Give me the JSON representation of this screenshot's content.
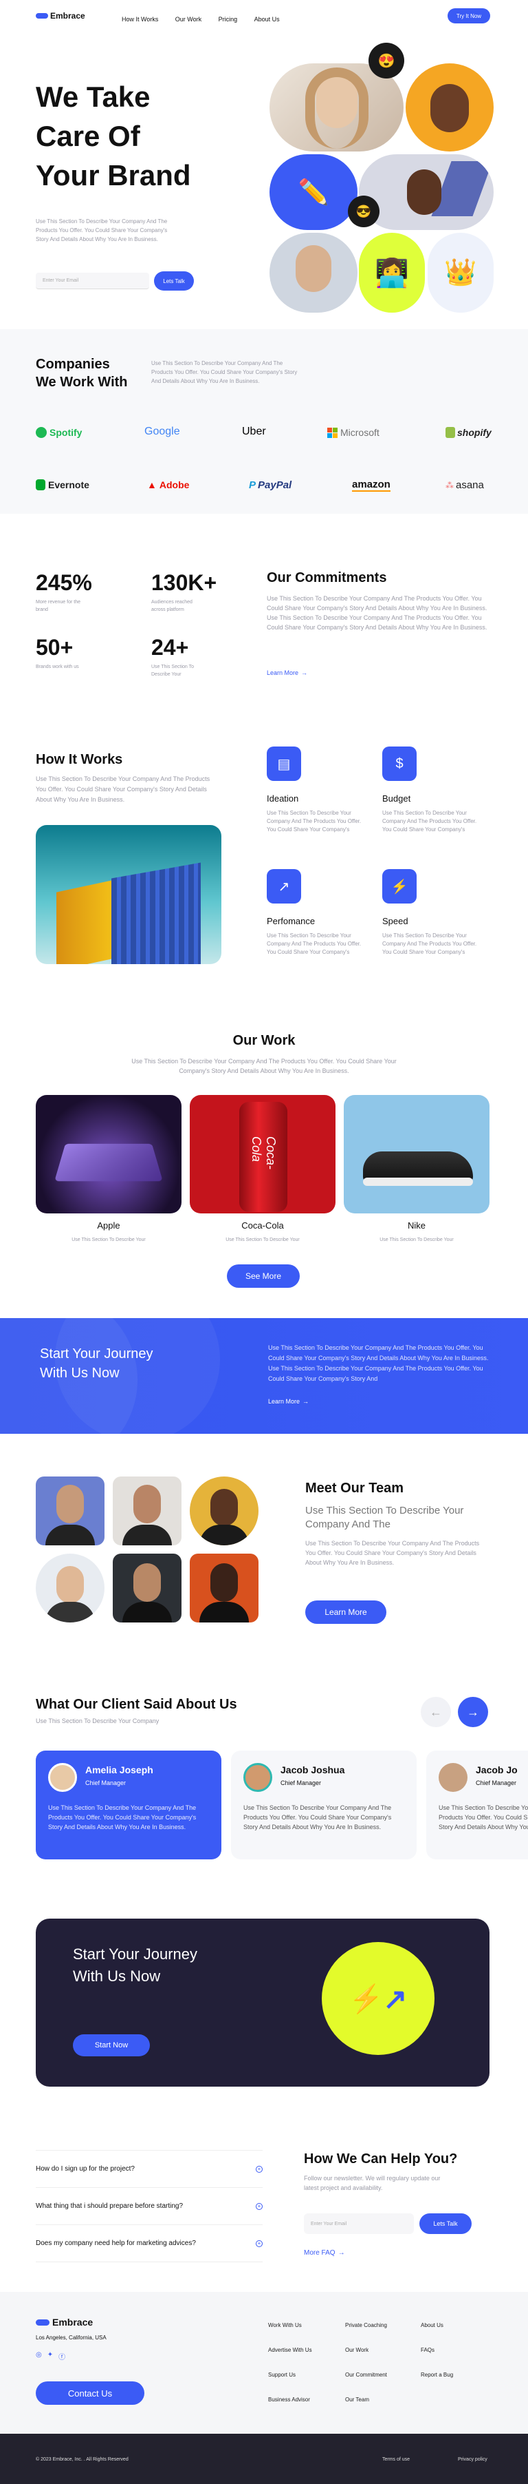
{
  "nav": {
    "logo": "Embrace",
    "links": [
      "How It Works",
      "Our Work",
      "Pricing",
      "About Us"
    ],
    "cta": "Try It Now"
  },
  "hero": {
    "line1": "We Take",
    "line2": "Care Of",
    "line3": "Your Brand",
    "desc": "Use This Section To Describe Your Company And The Products You Offer. You Could Share Your Company's Story And Details About Why You Are In Business.",
    "email_placeholder": "Enter Your Email",
    "button": "Lets Talk"
  },
  "companies": {
    "title1": "Companies",
    "title2": "We Work With",
    "desc": "Use This Section To Describe Your Company And The Products You Offer. You Could Share Your Company's Story And Details About Why You Are In Business.",
    "logos": [
      "Spotify",
      "Google",
      "Uber",
      "Microsoft",
      "shopify",
      "Evernote",
      "Adobe",
      "PayPal",
      "amazon",
      "asana"
    ]
  },
  "stats": {
    "items": [
      {
        "value": "245%",
        "label": "More revenue for the brand"
      },
      {
        "value": "130K+",
        "label": "Audiences reached across platform"
      },
      {
        "value": "50+",
        "label": "Brands work with us"
      },
      {
        "value": "24+",
        "label": "Use This Section To Describe Your"
      }
    ],
    "title": "Our Commitments",
    "desc": "Use This Section To Describe Your Company And The Products You Offer. You Could Share Your Company's Story And Details About Why You Are In Business. Use This Section To Describe Your Company And The Products You Offer. You Could Share Your Company's Story And Details About Why You Are In Business.",
    "link": "Learn More"
  },
  "how": {
    "title": "How It Works",
    "desc": "Use This Section To Describe Your Company And The Products You Offer. You Could Share Your Company's Story And Details About Why You Are In Business.",
    "features": [
      {
        "title": "Ideation",
        "desc": "Use This Section To Describe Your Company And The Products You Offer. You Could Share Your Company's"
      },
      {
        "title": "Budget",
        "desc": "Use This Section To Describe Your Company And The Products You Offer. You Could Share Your Company's"
      },
      {
        "title": "Perfomance",
        "desc": "Use This Section To Describe Your Company And The Products You Offer. You Could Share Your Company's"
      },
      {
        "title": "Speed",
        "desc": "Use This Section To Describe Your Company And The Products You Offer. You Could Share Your Company's"
      }
    ]
  },
  "work": {
    "title": "Our Work",
    "desc": "Use This Section To Describe Your Company And The Products You Offer. You Could Share Your Company's Story And Details About Why You Are In Business.",
    "items": [
      {
        "name": "Apple",
        "desc": "Use This Section To Describe Your"
      },
      {
        "name": "Coca-Cola",
        "desc": "Use This Section To Describe Your"
      },
      {
        "name": "Nike",
        "desc": "Use This Section To Describe Your"
      }
    ],
    "button": "See More"
  },
  "journey": {
    "title1": "Start Your Journey",
    "title2": "With Us Now",
    "desc": "Use This Section To Describe Your Company And The Products You Offer. You Could Share Your Company's Story And Details About Why You Are In Business. Use This Section To Describe Your Company And The Products You Offer. You Could Share Your Company's Story And",
    "link": "Learn More"
  },
  "team": {
    "title": "Meet Our Team",
    "subtitle": "Use This Section To Describe Your Company And The",
    "desc": "Use This Section To Describe Your Company And The Products You Offer. You Could Share Your Company's Story And Details About Why You Are In Business.",
    "button": "Learn More"
  },
  "testimonials": {
    "title": "What Our Client Said About Us",
    "subtitle": "Use This Section To Describe Your Company",
    "cards": [
      {
        "name": "Amelia Joseph",
        "role": "Chief Manager",
        "text": "Use This Section To Describe Your Company And The Products You Offer. You Could Share Your Company's Story And Details About Why You Are In Business."
      },
      {
        "name": "Jacob Joshua",
        "role": "Chief Manager",
        "text": "Use This Section To Describe Your Company And The Products You Offer. You Could Share Your Company's Story And Details About Why You Are In Business."
      },
      {
        "name": "Jacob Jo",
        "role": "Chief Manager",
        "text": "Use This Section To Describe Your Company And The Products You Offer. You Could Share Your Company's Story And Details About Why You Are In Business."
      }
    ]
  },
  "cta": {
    "title1": "Start Your Journey",
    "title2": "With Us Now",
    "button": "Start Now"
  },
  "faq": {
    "items": [
      "How do I sign up for the project?",
      "What thing that i should prepare before starting?",
      "Does my company need help for marketing advices?"
    ],
    "title": "How We Can Help You?",
    "desc": "Follow our newsletter. We will regulary update our latest project and availability.",
    "placeholder": "Enter Your Email",
    "button": "Lets Talk",
    "link": "More FAQ"
  },
  "footer": {
    "logo": "Embrace",
    "address": "Los Angeles, California, USA",
    "contact": "Contact Us",
    "col1": [
      "Work With Us",
      "Advertise With Us",
      "Support Us",
      "Business Advisor"
    ],
    "col2": [
      "Private Coaching",
      "Our Work",
      "Our Commitment",
      "Our Team"
    ],
    "col3": [
      "About Us",
      "FAQs",
      "Report a Bug"
    ],
    "copyright": "© 2023 Embrace, Inc. . All Rights Reserved",
    "terms": "Terms of use",
    "privacy": "Privacy policy"
  }
}
